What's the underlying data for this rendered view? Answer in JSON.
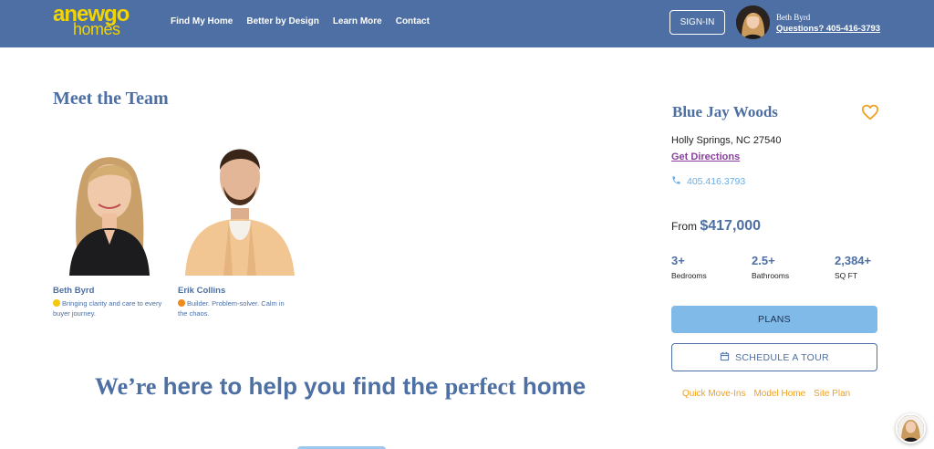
{
  "header": {
    "logo": {
      "line1": "anewgo",
      "line2": "homes"
    },
    "nav": [
      {
        "label": "Find My Home"
      },
      {
        "label": "Better by Design"
      },
      {
        "label": "Learn More"
      },
      {
        "label": "Contact"
      }
    ],
    "signin_label": "SIGN-IN",
    "agent_name": "Beth Byrd",
    "agent_phone_link": "Questions? 405-416-3793"
  },
  "team": {
    "title": "Meet the Team",
    "members": [
      {
        "name": "Beth Byrd",
        "description": "Bringing clarity and care to every buyer journey.",
        "dot_color": "#f2c811"
      },
      {
        "name": "Erik Collins",
        "description": "Builder. Problem-solver. Calm in the chaos.",
        "dot_color": "#f08a1c"
      }
    ]
  },
  "tagline": {
    "part1": "We’re",
    "part2": " here to help you find the ",
    "part3": "perfect",
    "part4": " home"
  },
  "community": {
    "name": "Blue Jay Woods",
    "address": "Holly Springs, NC 27540",
    "directions_label": "Get Directions",
    "phone": "405.416.3793",
    "price_prefix": "From ",
    "price": "$417,000",
    "stats": [
      {
        "value": "3+",
        "label": "Bedrooms"
      },
      {
        "value": "2.5+",
        "label": "Bathrooms"
      },
      {
        "value": "2,384+",
        "label": "SQ FT"
      }
    ],
    "plans_label": "PLANS",
    "tour_label": "SCHEDULE A TOUR",
    "links": [
      {
        "label": "Quick Move-Ins"
      },
      {
        "label": "Model Home"
      },
      {
        "label": "Site Plan"
      }
    ]
  },
  "colors": {
    "brand_blue": "#4d6fa3",
    "accent_yellow": "#f2d400",
    "link_purple": "#8a3fa0",
    "link_orange": "#f0a020",
    "button_blue": "#7fbae9"
  }
}
